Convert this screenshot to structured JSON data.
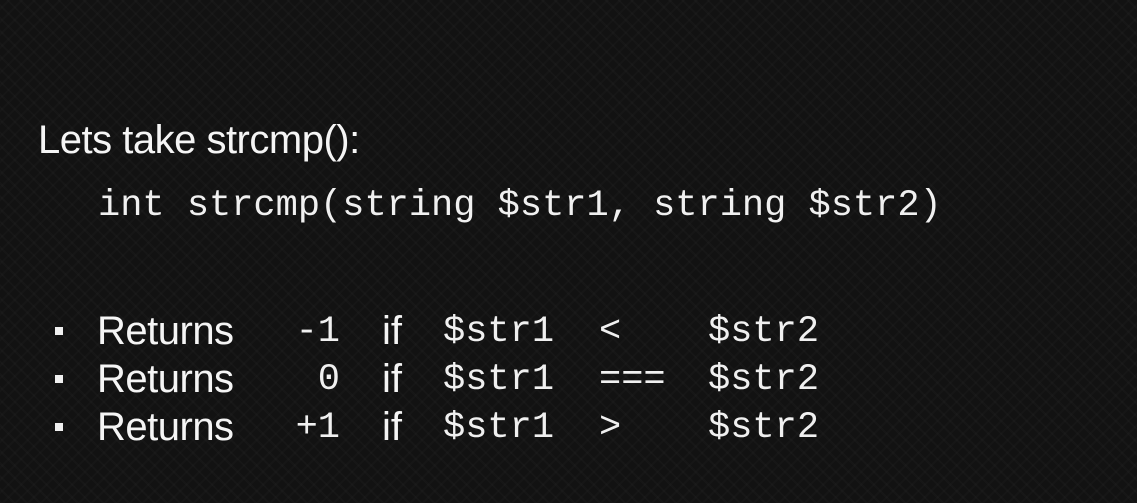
{
  "slide": {
    "heading": "Lets take strcmp():",
    "signature": "int strcmp(string $str1, string $str2)",
    "items": [
      {
        "word": "Returns",
        "value": "-1",
        "keyword": "if",
        "lhs": "$str1",
        "operator": "<",
        "rhs": "$str2"
      },
      {
        "word": "Returns",
        "value": "0",
        "keyword": "if",
        "lhs": "$str1",
        "operator": "===",
        "rhs": "$str2"
      },
      {
        "word": "Returns",
        "value": "+1",
        "keyword": "if",
        "lhs": "$str1",
        "operator": ">",
        "rhs": "$str2"
      }
    ]
  },
  "colors": {
    "background": "#121212",
    "text": "#f2f2f2"
  }
}
